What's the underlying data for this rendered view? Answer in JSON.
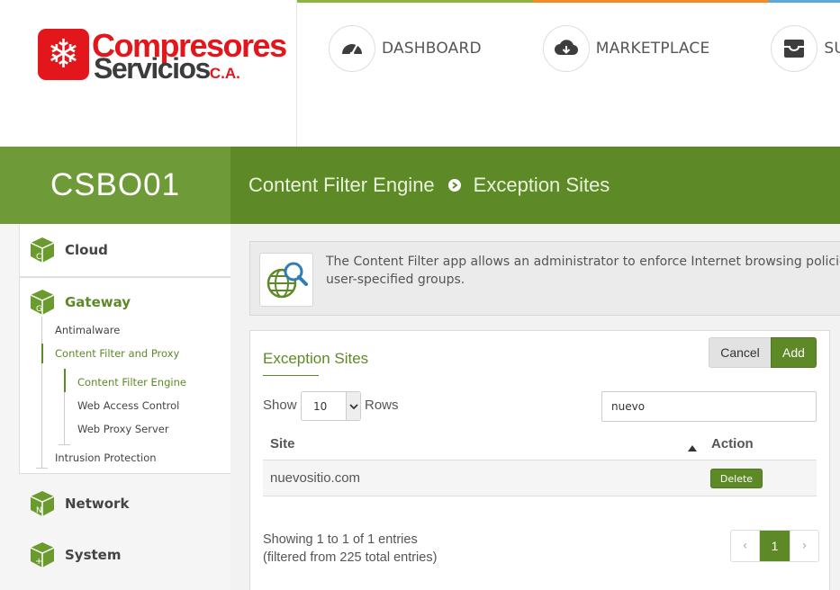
{
  "brand": {
    "line1": "Compresores",
    "line2": "Servicios",
    "suffix": "C.A.",
    "primary_color": "#e3161b"
  },
  "nav": [
    {
      "label": "DASHBOARD",
      "icon": "speedometer-icon"
    },
    {
      "label": "MARKETPLACE",
      "icon": "cloud-download-icon"
    },
    {
      "label": "SU",
      "icon": "inbox-icon"
    }
  ],
  "top_stripe_colors": [
    "#8cb441",
    "#f28c28",
    "#5aa9d8"
  ],
  "band": {
    "hostname": "CSBO01",
    "breadcrumb": [
      "Content Filter Engine",
      "Exception Sites"
    ],
    "color": "#5d8a26"
  },
  "sidebar": {
    "sections": [
      {
        "label": "Cloud",
        "letter": "C"
      },
      {
        "label": "Gateway",
        "letter": "G"
      },
      {
        "label": "Network",
        "letter": "N"
      },
      {
        "label": "System",
        "letter": "+"
      }
    ],
    "gateway_items": {
      "antimalware": "Antimalware",
      "content_filter_proxy": "Content Filter and Proxy",
      "content_filter_engine": "Content Filter Engine",
      "web_access_control": "Web Access Control",
      "web_proxy_server": "Web Proxy Server",
      "intrusion_protection": "Intrusion Protection"
    }
  },
  "info": {
    "line1": "The Content Filter app allows an administrator to enforce Internet browsing policies",
    "line2": "user-specified groups.",
    "icon": "globe-search-icon"
  },
  "panel": {
    "title": "Exception Sites",
    "cancel_label": "Cancel",
    "add_label": "Add",
    "show_label": "Show",
    "rows_value": "10",
    "rows_label": "Rows",
    "search_value": "nuevo",
    "columns": {
      "site": "Site",
      "action": "Action"
    },
    "rows": [
      {
        "site": "nuevositio.com",
        "action_label": "Delete"
      }
    ],
    "showing_text": "Showing 1 to 1 of 1 entries (filtered from 225 total entries)",
    "pagination": {
      "prev": "‹",
      "current": "1",
      "next": "›"
    }
  }
}
